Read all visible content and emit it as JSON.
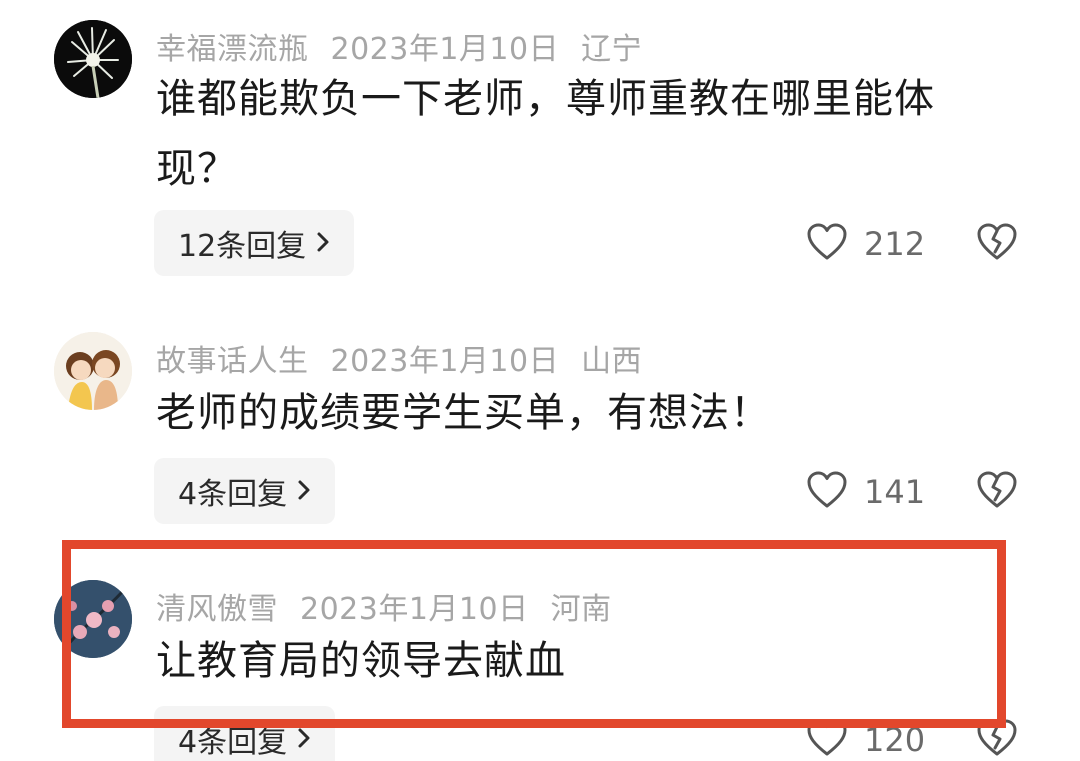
{
  "comments": [
    {
      "username": "幸福漂流瓶",
      "date": "2023年1月10日",
      "location": "辽宁",
      "text": "谁都能欺负一下老师，尊师重教在哪里能体现？",
      "replies_label": "12条回复",
      "likes": "212"
    },
    {
      "username": "故事话人生",
      "date": "2023年1月10日",
      "location": "山西",
      "text": "老师的成绩要学生买单，有想法！",
      "replies_label": "4条回复",
      "likes": "141"
    },
    {
      "username": "清风傲雪",
      "date": "2023年1月10日",
      "location": "河南",
      "text": "让教育局的领导去献血",
      "replies_label": "4条回复",
      "likes": "120"
    }
  ],
  "icons": {
    "like": "heart-outline-icon",
    "dislike": "broken-heart-icon",
    "chevron": "chevron-right-icon"
  },
  "colors": {
    "highlight_border": "#e2472c",
    "meta_text": "#a6a6a6",
    "reply_pill_bg": "#f4f4f4"
  }
}
